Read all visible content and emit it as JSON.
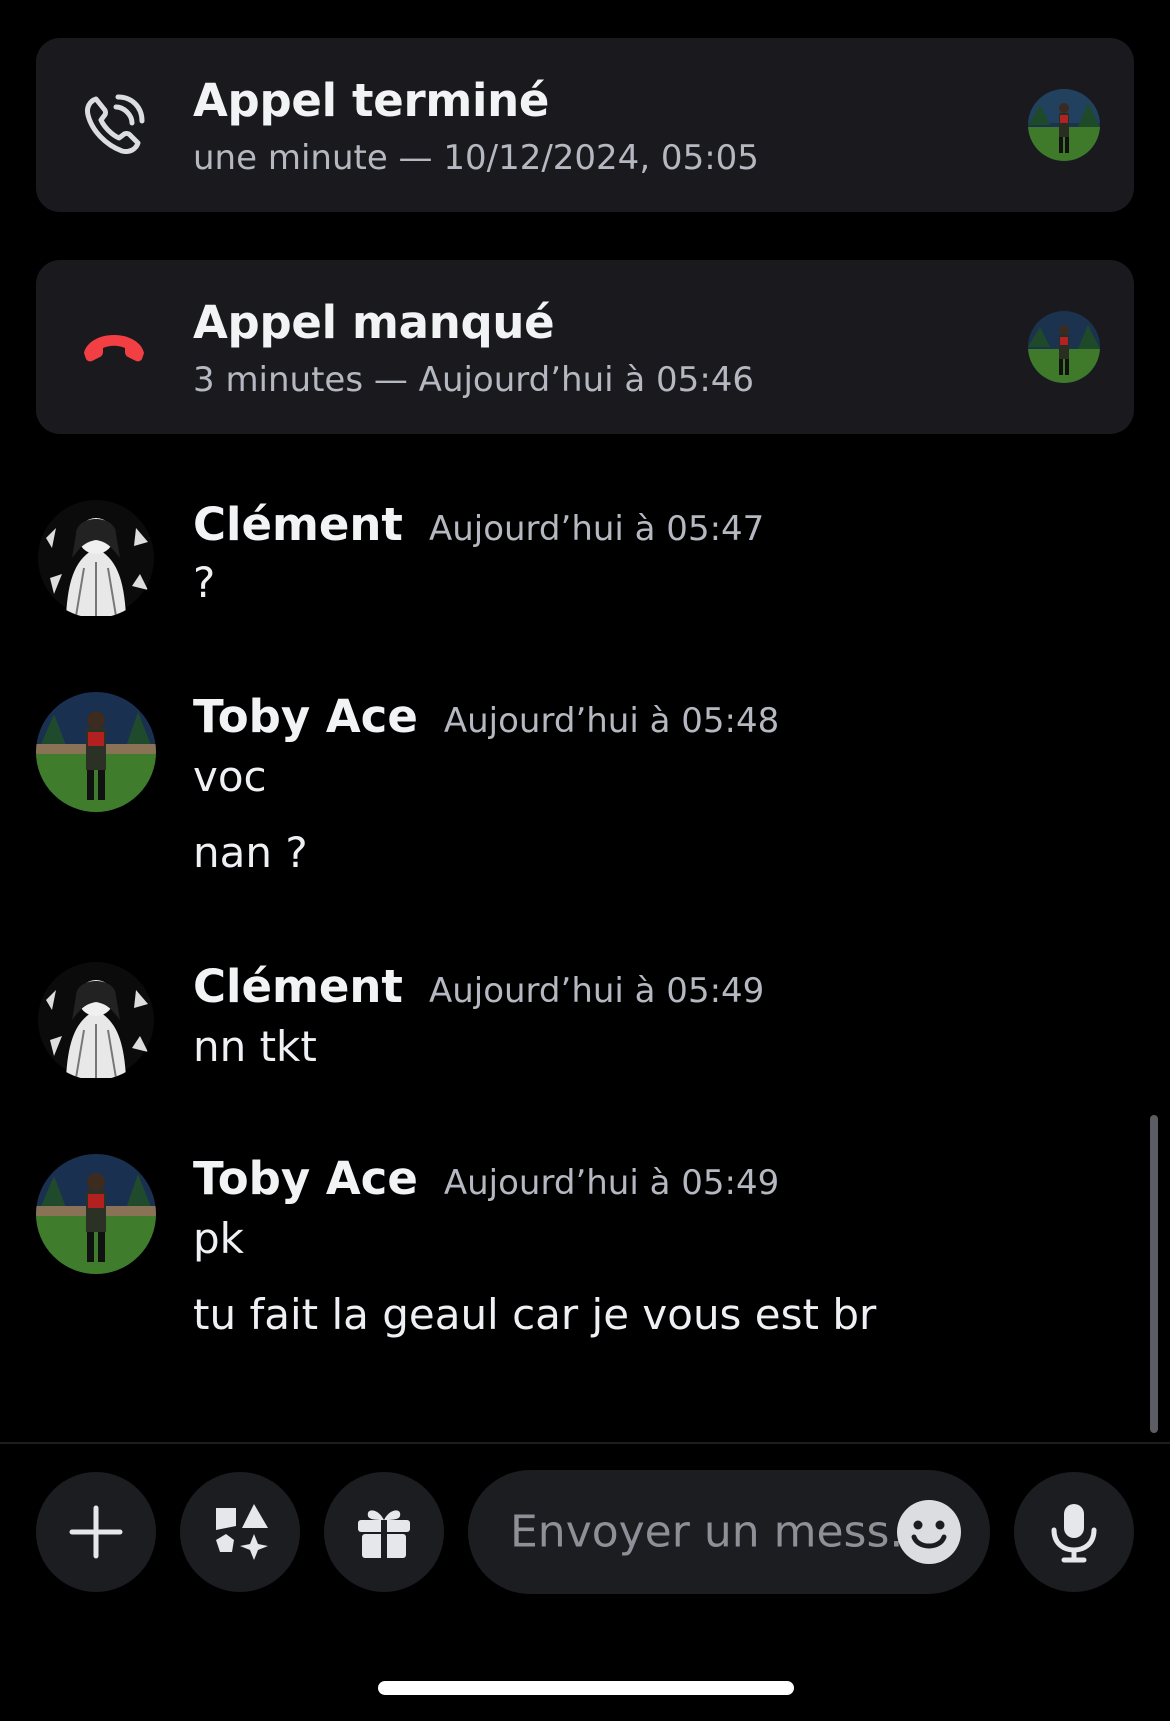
{
  "calls": [
    {
      "title": "Appel terminé",
      "subtitle": "une minute — 10/12/2024, 05:05",
      "status": "ended",
      "icon": "phone-ringing-icon",
      "color": "#dcdde1"
    },
    {
      "title": "Appel manqué",
      "subtitle": "3 minutes — Aujourd’hui à 05:46",
      "status": "missed",
      "icon": "phone-hangup-icon",
      "color": "#f23f43"
    }
  ],
  "messages": [
    {
      "author": "Clément",
      "timestamp": "Aujourd’hui à 05:47",
      "lines": [
        "?"
      ],
      "avatar": "clement-avatar"
    },
    {
      "author": "Toby Ace",
      "timestamp": "Aujourd’hui à 05:48",
      "lines": [
        "voc",
        "nan ?"
      ],
      "avatar": "toby-avatar"
    },
    {
      "author": "Clément",
      "timestamp": "Aujourd’hui à 05:49",
      "lines": [
        "nn tkt"
      ],
      "avatar": "clement-avatar"
    },
    {
      "author": "Toby Ace",
      "timestamp": "Aujourd’hui à 05:49",
      "lines": [
        "pk",
        "tu fait la geaul car je vous est br"
      ],
      "avatar": "toby-avatar"
    }
  ],
  "composer": {
    "placeholder": "Envoyer un mess..",
    "buttons": [
      "plus-icon",
      "apps-icon",
      "gift-icon",
      "emoji-icon",
      "microphone-icon"
    ]
  },
  "colors": {
    "background": "#000000",
    "card": "#1a1a1e",
    "missed": "#f23f43",
    "muted_text": "#b5b8c0"
  }
}
